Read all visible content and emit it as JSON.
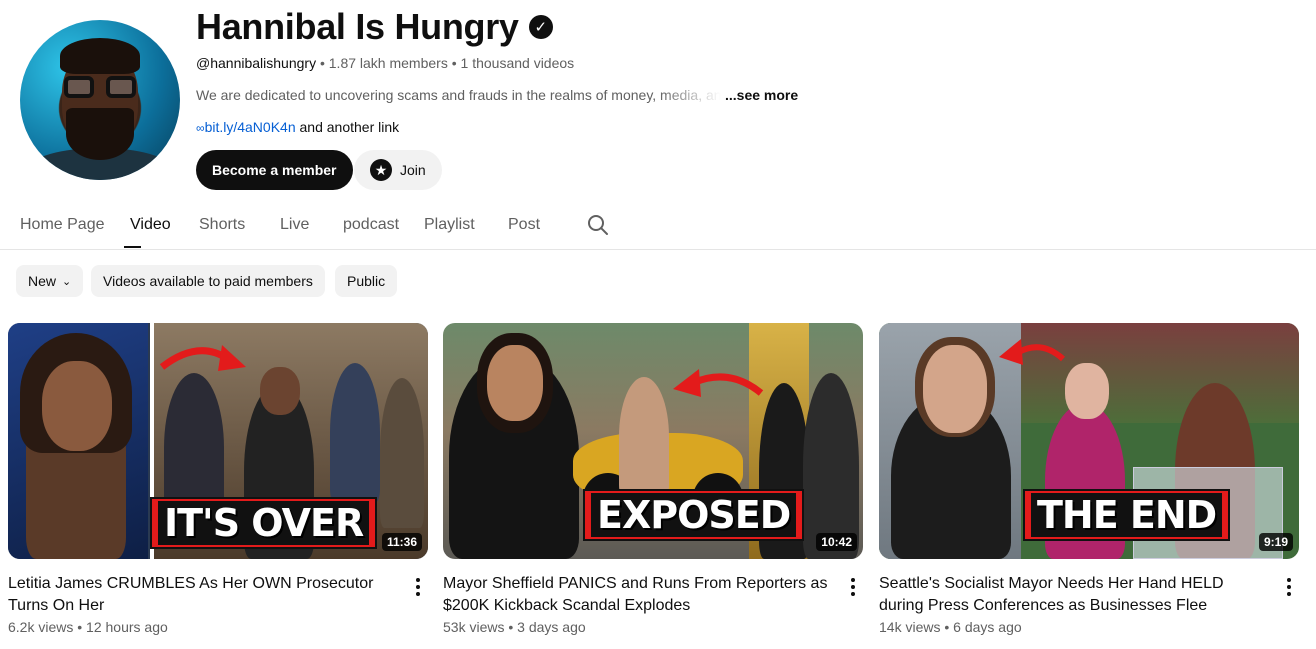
{
  "channel": {
    "name": "Hannibal Is Hungry",
    "verified_icon": "verified-check-icon",
    "handle": "@hannibalishungry",
    "members": "1.87 lakh members",
    "videos": "1 thousand videos",
    "description": "We are dedicated to uncovering scams and frauds in the realms of money, media, and",
    "see_more": "...see more",
    "link": "bit.ly/4aN0K4n",
    "other_link": "and another link",
    "member_button": "Become a member",
    "join_button": "Join"
  },
  "tabs": [
    "Home Page",
    "Video",
    "Shorts",
    "Live",
    "podcast",
    "Playlist",
    "Post"
  ],
  "active_tab": "Video",
  "chips": {
    "sort": "New",
    "paid": "Videos available to paid members",
    "public": "Public"
  },
  "videos": [
    {
      "title": "Letitia James CRUMBLES As Her OWN Prosecutor Turns On Her",
      "views": "6.2k views",
      "age": "12 hours ago",
      "duration": "11:36",
      "overlay": "IT'S OVER"
    },
    {
      "title": "Mayor Sheffield PANICS and Runs From Reporters as $200K Kickback Scandal Explodes",
      "views": "53k views",
      "age": "3 days ago",
      "duration": "10:42",
      "overlay": "EXPOSED"
    },
    {
      "title": "Seattle's Socialist Mayor Needs Her Hand HELD during Press Conferences as Businesses Flee",
      "views": "14k views",
      "age": "6 days ago",
      "duration": "9:19",
      "overlay": "THE END"
    }
  ],
  "colors": {
    "accent_link": "#065fd4",
    "overlay_red": "#e31b1b",
    "text_primary": "#0f0f0f",
    "text_secondary": "#606060"
  },
  "separator": "•"
}
